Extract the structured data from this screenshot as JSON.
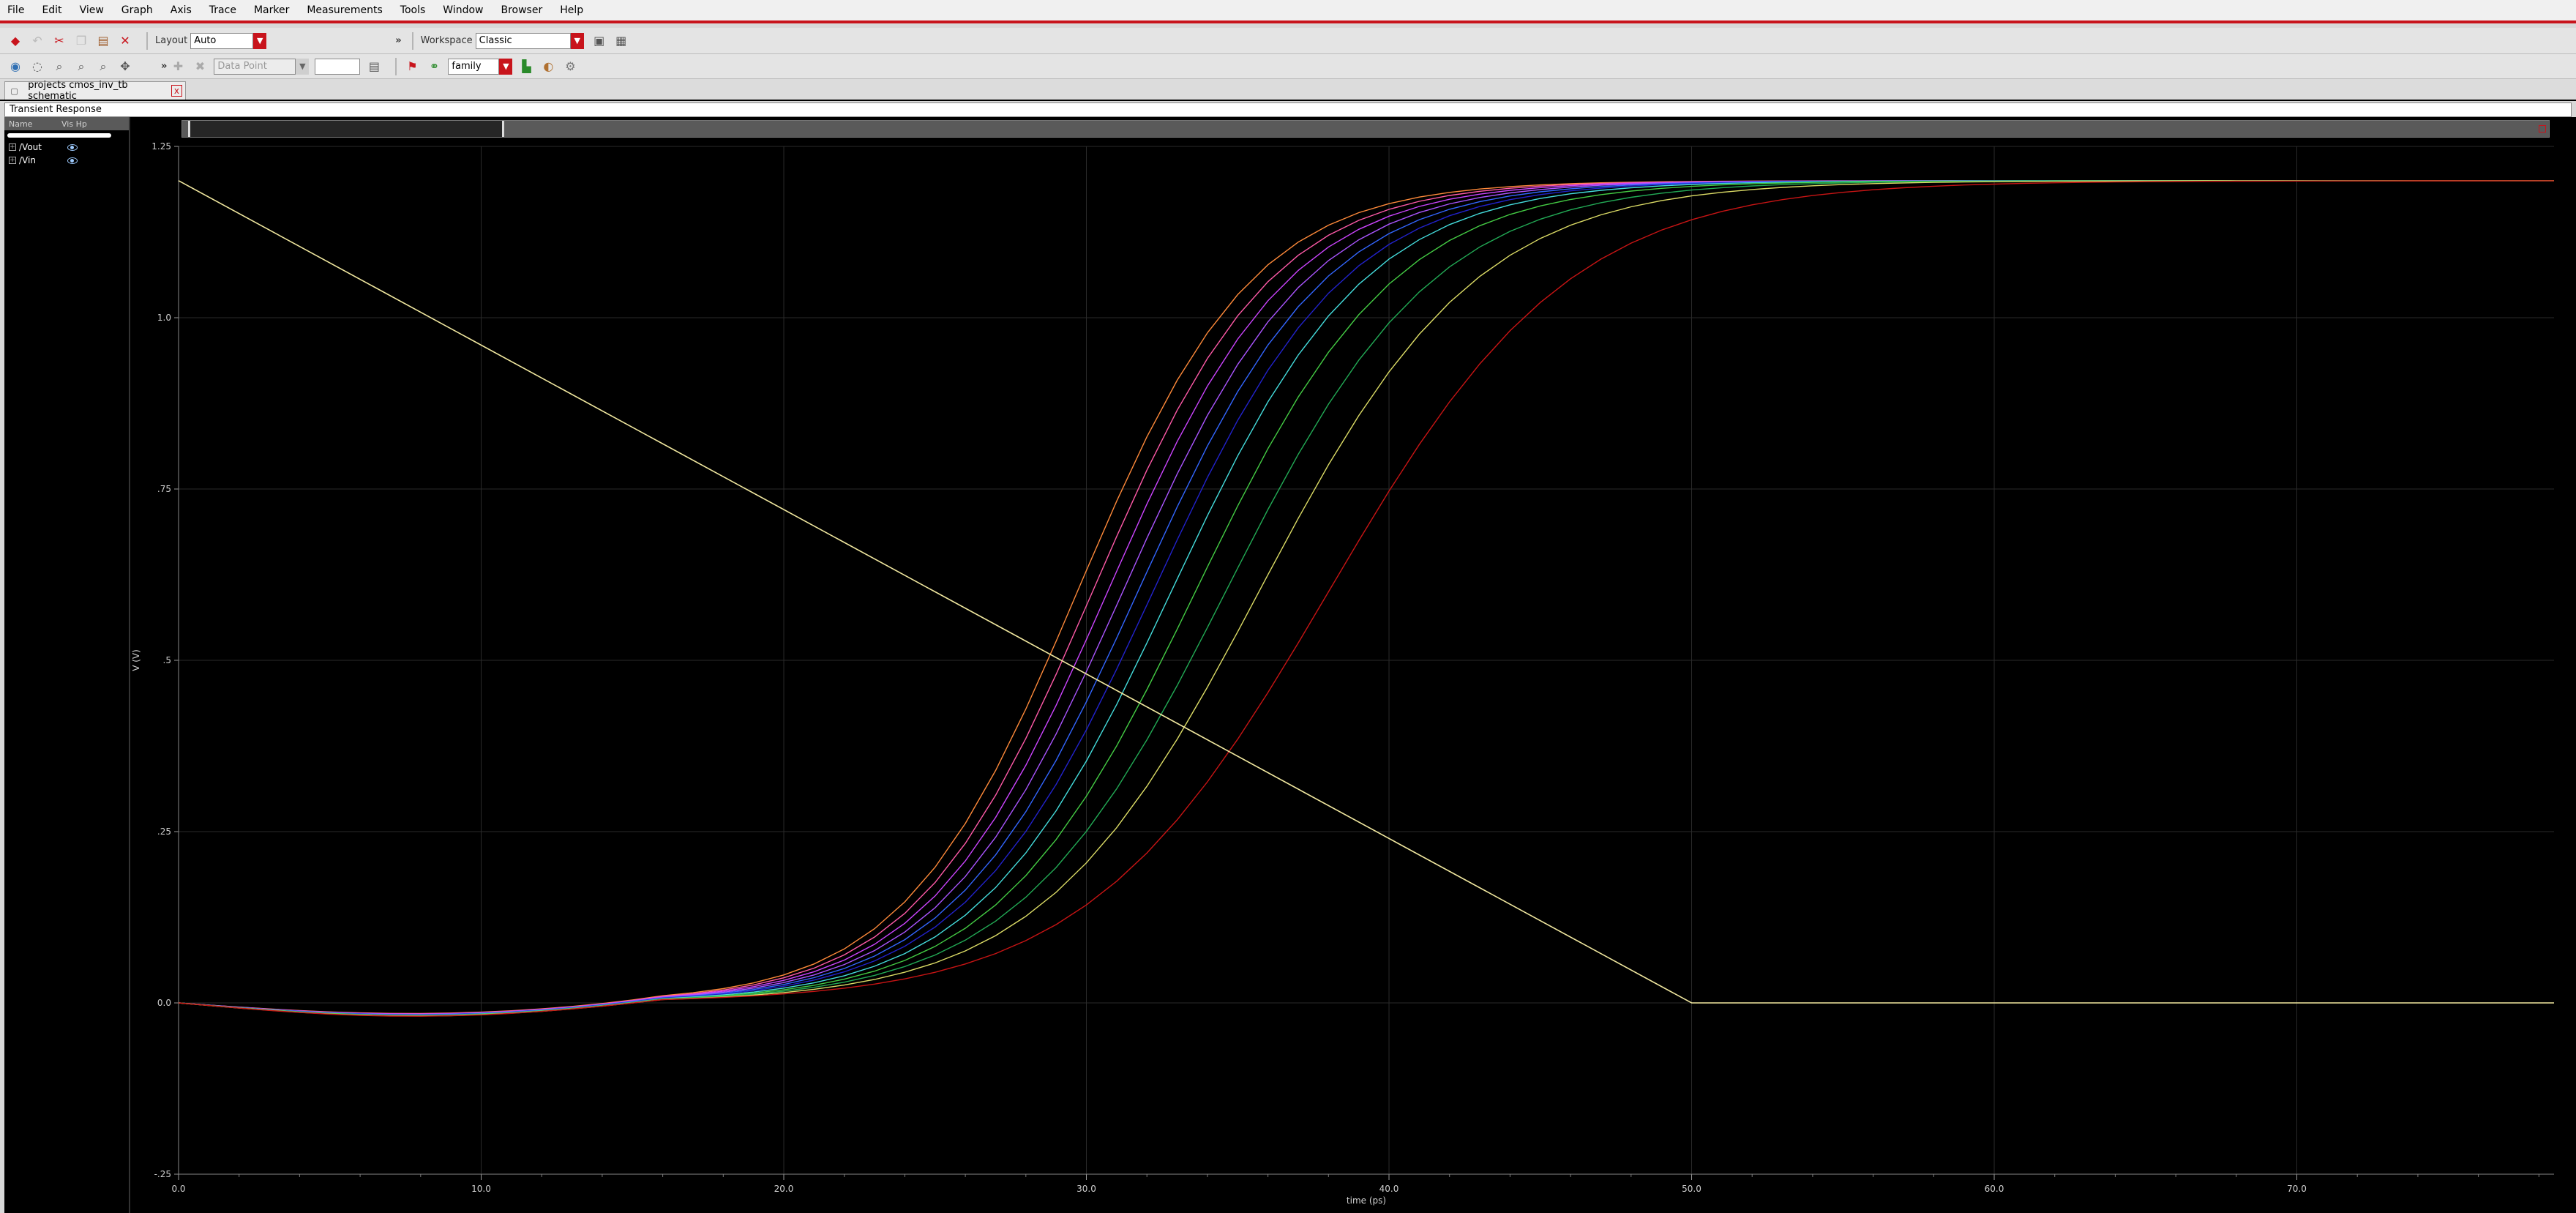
{
  "menu": [
    "File",
    "Edit",
    "View",
    "Graph",
    "Axis",
    "Trace",
    "Marker",
    "Measurements",
    "Tools",
    "Window",
    "Browser",
    "Help"
  ],
  "toolbar1": {
    "layout_label": "Layout",
    "layout_value": "Auto",
    "workspace_label": "Workspace",
    "workspace_value": "Classic",
    "more_glyph": "»"
  },
  "toolbar2": {
    "more_glyph": "»",
    "marker_type": "Data Point",
    "family_value": "family"
  },
  "tab": {
    "title": "projects cmos_inv_tb schematic",
    "close": "x"
  },
  "window_title": "Transient Response",
  "browser": {
    "columns": [
      "Name",
      "Vis Hp"
    ],
    "traces": [
      {
        "name": "/Vout",
        "expand": "+"
      },
      {
        "name": "/Vin",
        "expand": "+"
      }
    ]
  },
  "colors": {
    "accent": "#c8141c",
    "plot_bg": "#000000",
    "grid": "#2a2a2a",
    "vin": "#f2e9a0",
    "vout_family": [
      "#ff8a3a",
      "#ff5aa8",
      "#cc44ff",
      "#aa55ff",
      "#3366ff",
      "#2222cc",
      "#44dddd",
      "#44cc44",
      "#22aa55",
      "#dddd66",
      "#c81414"
    ]
  },
  "chart_data": {
    "type": "line",
    "xlabel": "time (ps)",
    "ylabel": "V (V)",
    "xlim": [
      0,
      78.5
    ],
    "ylim": [
      -0.25,
      1.25
    ],
    "x_ticks": [
      "0.0",
      "10.0",
      "20.0",
      "30.0",
      "40.0",
      "50.0",
      "60.0",
      "70.0"
    ],
    "y_ticks": [
      "-.25",
      "0.0",
      ".25",
      ".5",
      ".75",
      "1.0",
      "1.25"
    ],
    "grid": true,
    "series": [
      {
        "name": "/Vin",
        "x": [
          0,
          50,
          78.5
        ],
        "y": [
          1.2,
          0.0,
          0.0
        ]
      }
    ],
    "vout_family": {
      "name": "/Vout",
      "x": [
        0,
        1,
        2,
        3,
        4,
        5,
        6,
        7,
        8,
        9,
        10,
        11,
        12,
        13,
        14,
        15,
        16,
        17,
        18,
        19,
        20,
        21,
        22,
        23,
        24,
        25,
        26,
        27,
        28,
        29,
        30,
        31,
        32,
        33,
        34,
        35,
        36,
        37,
        38,
        39,
        40,
        41,
        42,
        43,
        44,
        45,
        46,
        47,
        48,
        49,
        50,
        51,
        52,
        53,
        54,
        55,
        56,
        57,
        58,
        59,
        60,
        61,
        62,
        63,
        64,
        65,
        66,
        67,
        68,
        69,
        70,
        71,
        72,
        73,
        74,
        75,
        76,
        77,
        78.5
      ],
      "t50": [
        29.7,
        30.2,
        30.7,
        31.2,
        31.7,
        32.2,
        32.8,
        33.6,
        34.6,
        35.7,
        38.0
      ],
      "width": [
        2.9,
        2.95,
        3.0,
        3.05,
        3.1,
        3.15,
        3.2,
        3.3,
        3.45,
        3.6,
        4.0
      ]
    }
  }
}
